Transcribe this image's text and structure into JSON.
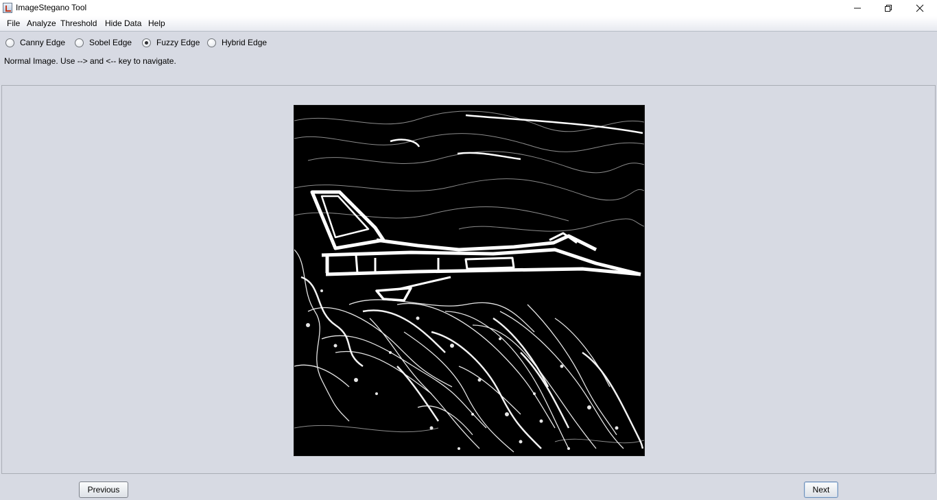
{
  "window": {
    "title": "ImageStegano Tool"
  },
  "menu": {
    "items": [
      "File",
      "Analyze",
      "Threshold",
      "Hide Data",
      "Help"
    ]
  },
  "edge_options": {
    "items": [
      {
        "label": "Canny Edge",
        "checked": false
      },
      {
        "label": "Sobel Edge",
        "checked": false
      },
      {
        "label": "Fuzzy Edge",
        "checked": true
      },
      {
        "label": "Hybrid Edge",
        "checked": false
      }
    ]
  },
  "status": {
    "text": "Normal Image. Use --> and <-- key to navigate."
  },
  "image": {
    "subject": "fuzzy edge-detected fighter jet over terrain",
    "background_color": "#000000",
    "edge_color": "#ffffff"
  },
  "navigation": {
    "previous_label": "Previous",
    "next_label": "Next"
  }
}
